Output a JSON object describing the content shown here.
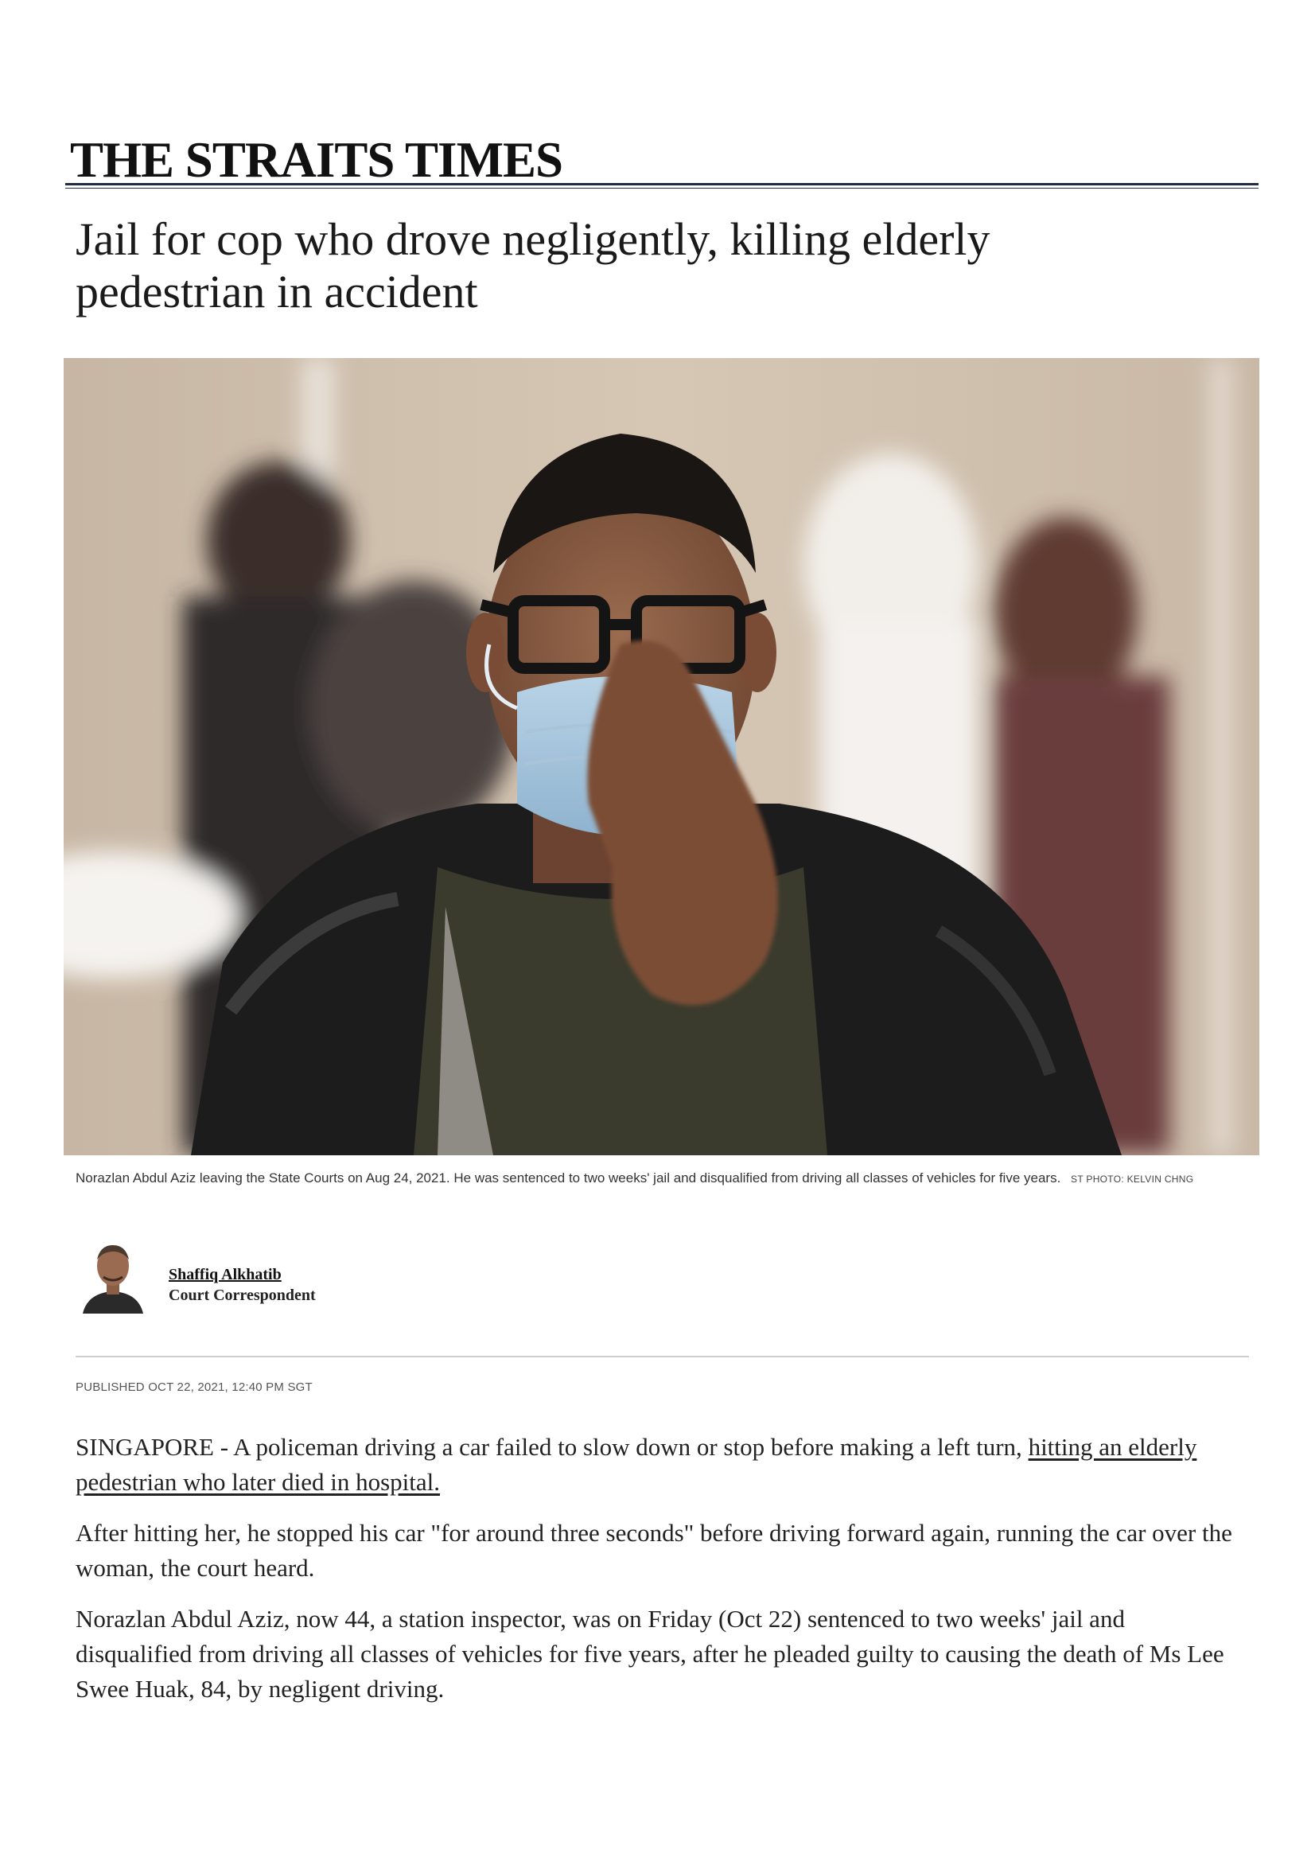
{
  "masthead": {
    "title": "THE STRAITS TIMES"
  },
  "article": {
    "headline": "Jail for cop who drove negligently, killing elderly pedestrian in accident",
    "photo": {
      "caption": "Norazlan Abdul Aziz leaving the State Courts on Aug 24, 2021. He was sentenced to two weeks' jail and disqualified from driving all classes of vehicles for five years.",
      "credit": "ST PHOTO: KELVIN CHNG"
    },
    "author": {
      "name": "Shaffiq Alkhatib",
      "role": "Court Correspondent"
    },
    "published": "PUBLISHED OCT 22, 2021, 12:40 PM SGT",
    "paragraphs": {
      "p1_text": "SINGAPORE - A policeman driving a car failed to slow down or stop before making a left turn, ",
      "p1_link": "hitting an elderly pedestrian who later died in hospital.",
      "p2": "After hitting her, he stopped his car \"for around three seconds\" before driving forward again, running the car over the woman, the court heard.",
      "p3": "Norazlan Abdul Aziz, now 44, a station inspector, was on Friday (Oct 22) sentenced to two weeks' jail and disqualified from driving all classes of vehicles for five years, after he pleaded guilty to causing the death of Ms Lee Swee Huak, 84, by negligent driving."
    }
  },
  "colors": {
    "masthead_rule": "#1f2a44",
    "text": "#1a1a1a",
    "divider": "#cfcfcf"
  }
}
